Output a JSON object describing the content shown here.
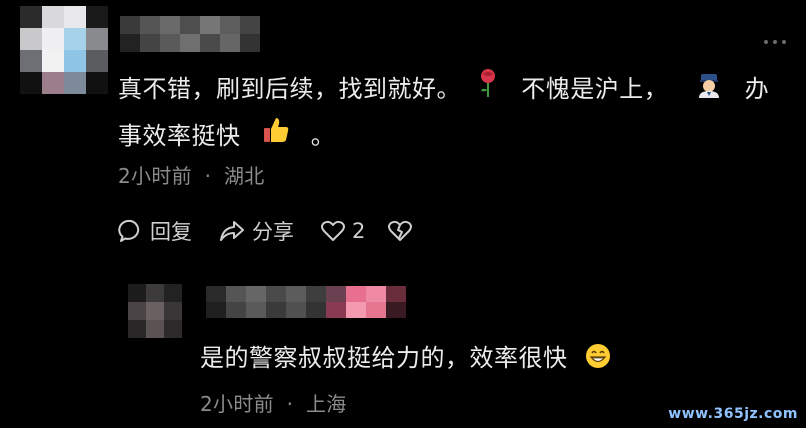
{
  "comment": {
    "text_line1_a": "真不错，刷到后续，找到就好。",
    "text_line1_b": "不愧是沪上，",
    "text_line1_c": "办",
    "text_line2_a": "事效率挺快",
    "text_line2_b": "。",
    "time": "2小时前",
    "separator": "·",
    "location": "湖北"
  },
  "actions": {
    "reply_label": "回复",
    "share_label": "分享",
    "like_count": "2"
  },
  "reply": {
    "text": "是的警察叔叔挺给力的，效率很快",
    "time": "2小时前",
    "separator": "·",
    "location": "上海"
  },
  "icons": {
    "rose": "rose-emoji-icon",
    "police": "police-officer-emoji-icon",
    "thumbs": "thumbs-up-emoji-icon",
    "grin": "grinning-face-emoji-icon",
    "reply": "speech-bubble-icon",
    "share": "share-arrow-icon",
    "like": "heart-outline-icon",
    "dislike": "broken-heart-icon",
    "more": "more-dots-icon"
  },
  "colors": {
    "background": "#000000",
    "text": "#ececec",
    "meta": "#8b8b8b"
  },
  "watermark": "www.365jz.com"
}
